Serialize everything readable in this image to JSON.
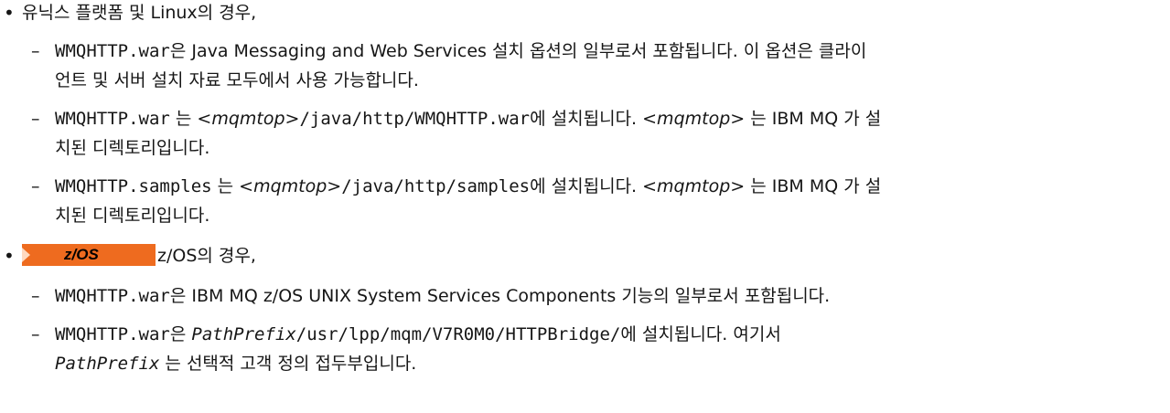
{
  "unix": {
    "heading": "유닉스 플랫폼 및 Linux의 경우,",
    "item1": {
      "code": "WMQHTTP.war",
      "text1": "은 Java Messaging and Web Services 설치 옵션의 일부로서 포함됩니다. 이 옵션은 클라이",
      "text2": "언트 및 서버 설치 자료 모두에서 사용 가능합니다."
    },
    "item2": {
      "code": "WMQHTTP.war",
      "is": " 는 ",
      "var": "<mqmtop>",
      "path": "/java/http/WMQHTTP.war",
      "tail": "에 설치됩니다. ",
      "var2": "<mqmtop>",
      "rest": " 는 IBM MQ 가 설",
      "cont": "치된 디렉토리입니다."
    },
    "item3": {
      "code": "WMQHTTP.samples",
      "is": " 는 ",
      "var": "<mqmtop>",
      "path": "/java/http/samples",
      "tail": "에 설치됩니다. ",
      "var2": "<mqmtop>",
      "rest": " 는 IBM MQ 가 설",
      "cont": "치된 디렉토리입니다."
    }
  },
  "zos": {
    "badge": "z/OS",
    "heading": "z/OS의 경우,",
    "item1": {
      "code": "WMQHTTP.war",
      "text": "은 IBM MQ z/OS UNIX System Services Components 기능의 일부로서 포함됩니다."
    },
    "item2": {
      "code": "WMQHTTP.war",
      "text": "은 ",
      "var": "PathPrefix",
      "path": "/usr/lpp/mqm/V7R0M0/HTTPBridge/",
      "tail": "에 설치됩니다. 여기서",
      "var2": "PathPrefix",
      "cont": "  는 선택적 고객 정의 접두부입니다."
    }
  },
  "colors": {
    "badge": "#ee6b1f",
    "text": "#161616"
  }
}
